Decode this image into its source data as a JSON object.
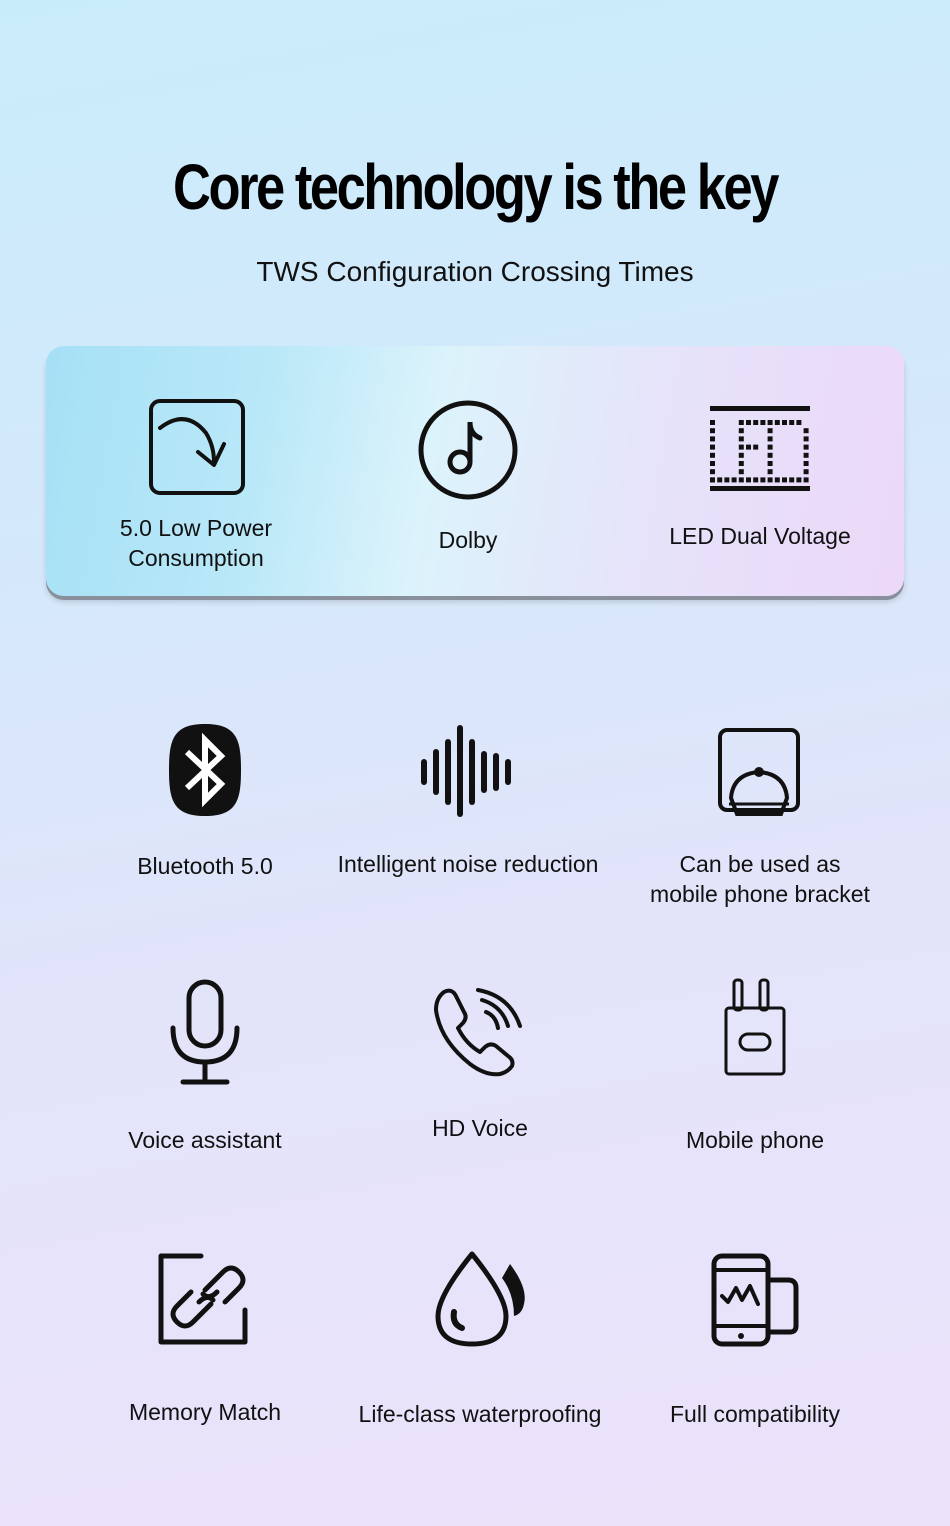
{
  "header": {
    "title": "Core technology is the key",
    "subtitle": "TWS Configuration Crossing Times"
  },
  "highlight_panel": {
    "items": [
      {
        "label": "5.0 Low Power Consumption",
        "line1": "5.0 Low Power",
        "line2": "Consumption",
        "icon": "power-curve-arrow-icon"
      },
      {
        "label": "Dolby",
        "icon": "music-note-circle-icon"
      },
      {
        "label": "LED Dual Voltage",
        "icon": "led-display-icon"
      }
    ]
  },
  "features": [
    {
      "label": "Bluetooth 5.0",
      "icon": "bluetooth-icon"
    },
    {
      "label": "Intelligent noise reduction",
      "icon": "sound-wave-icon"
    },
    {
      "label": "Can be used as mobile phone bracket",
      "line1": "Can be used as",
      "line2": "mobile phone bracket",
      "icon": "ring-holder-icon"
    },
    {
      "label": "Voice assistant",
      "icon": "microphone-icon"
    },
    {
      "label": "HD Voice",
      "icon": "phone-call-icon"
    },
    {
      "label": "Mobile phone",
      "icon": "charger-plug-icon"
    },
    {
      "label": "Memory Match",
      "icon": "link-icon"
    },
    {
      "label": "Life-class waterproofing",
      "icon": "water-drop-icon"
    },
    {
      "label": "Full compatibility",
      "icon": "phone-compatibility-icon"
    }
  ]
}
